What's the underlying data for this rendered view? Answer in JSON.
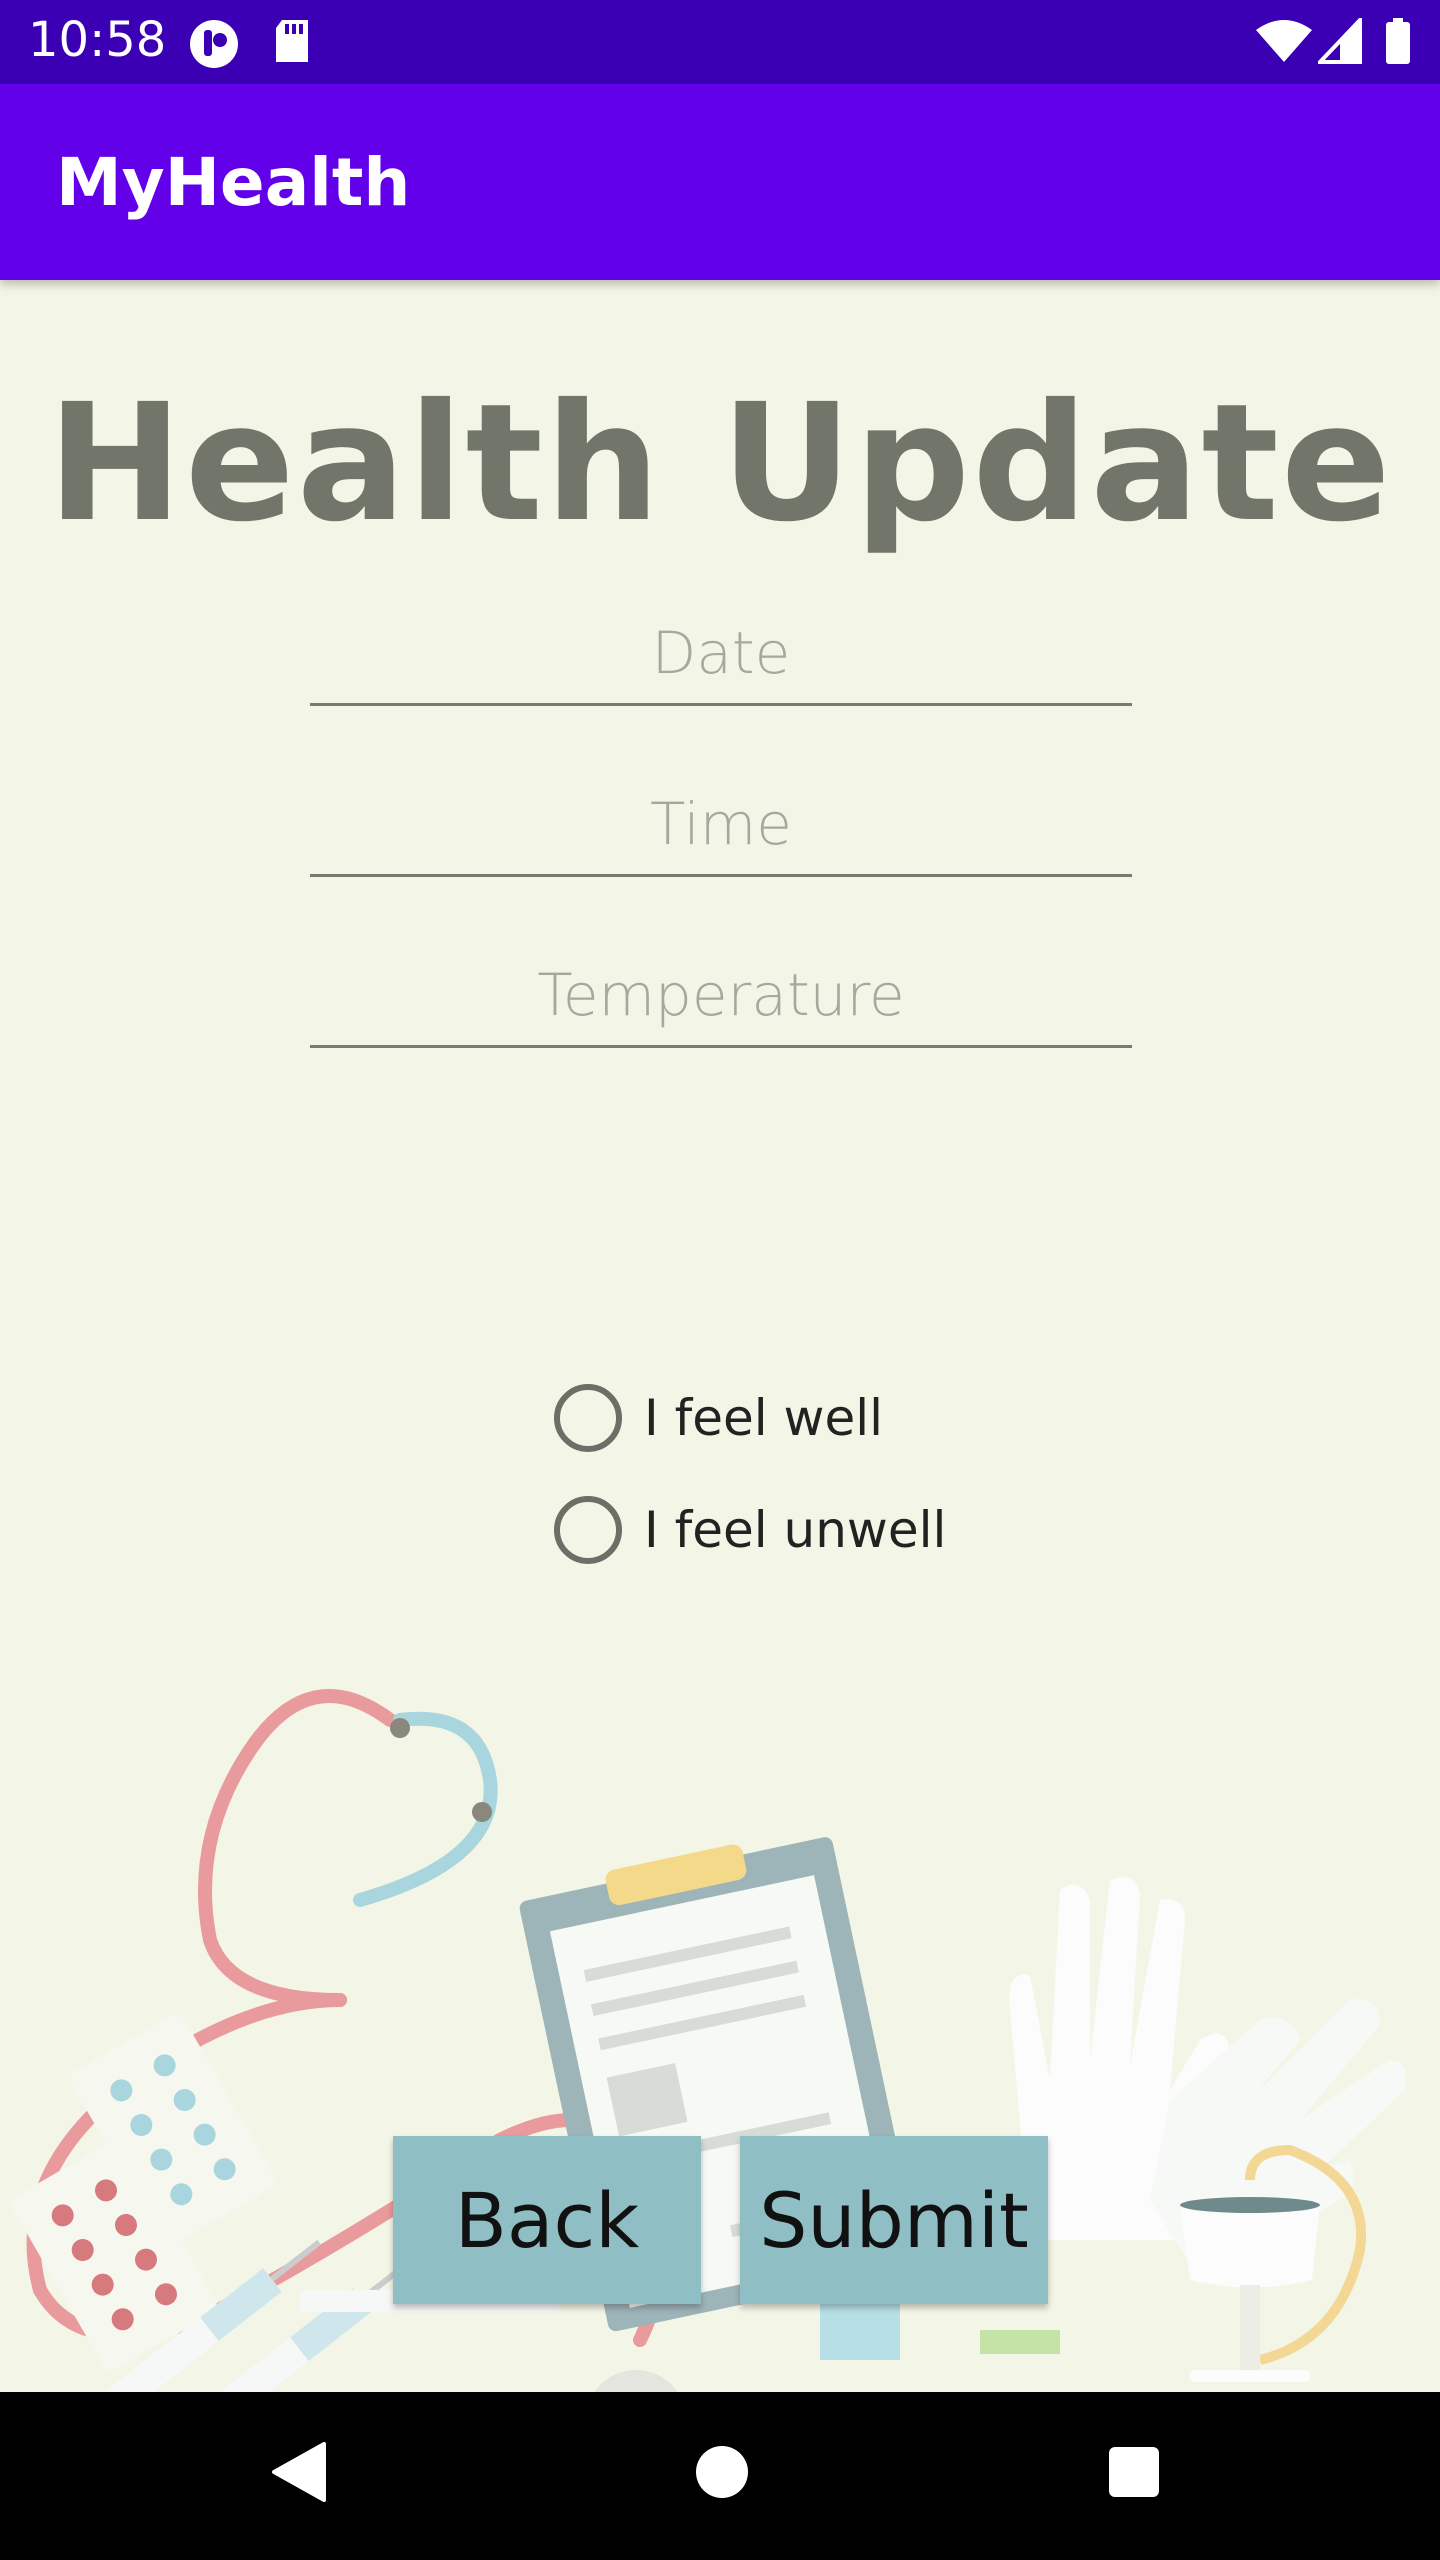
{
  "status_bar": {
    "time": "10:58",
    "icons": [
      "notification-app-icon",
      "sd-card-icon",
      "wifi-icon",
      "cellular-signal-icon",
      "battery-icon"
    ]
  },
  "app_bar": {
    "title": "MyHealth",
    "color": "#6200ea"
  },
  "form": {
    "title": "Health Update",
    "date_placeholder": "Date",
    "time_placeholder": "Time",
    "temperature_placeholder": "Temperature",
    "radio_options": [
      {
        "label": "I feel well",
        "selected": false
      },
      {
        "label": "I feel unwell",
        "selected": false
      }
    ]
  },
  "buttons": {
    "back": "Back",
    "submit": "Submit",
    "color": "#8fbfc4"
  },
  "nav_bar": {
    "icons": [
      "back-triangle-icon",
      "home-circle-icon",
      "recents-square-icon"
    ]
  }
}
